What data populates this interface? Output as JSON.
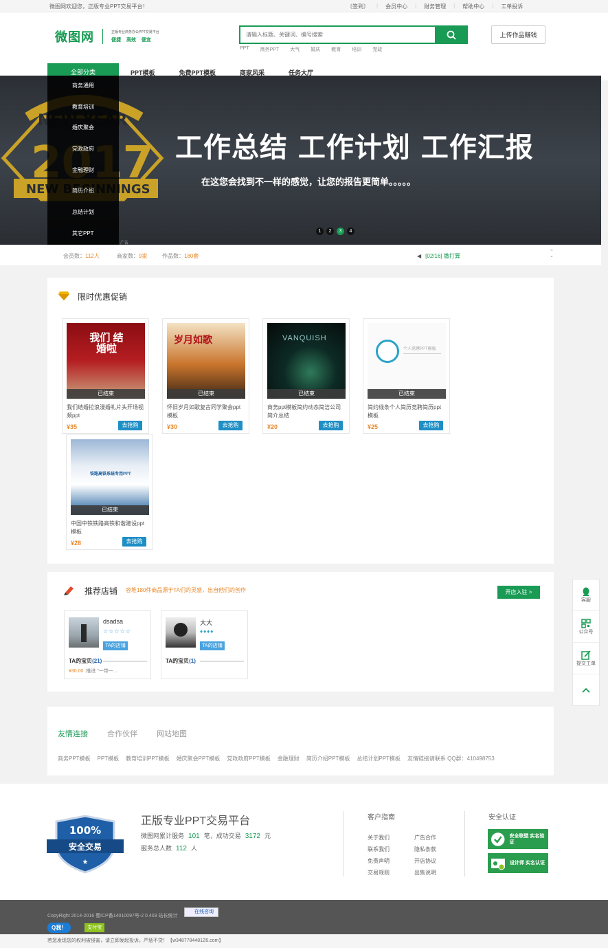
{
  "topbar": {
    "welcome": "微图网欢迎您，正版专业PPT交易平台！",
    "links": [
      "〔签到〕",
      "会员中心",
      "财务管理",
      "帮助中心",
      "工单投诉"
    ]
  },
  "header": {
    "logo": "微图网",
    "slogan": "正版专业商务办公PPT交易平台",
    "slogan2": "便捷 高效 便宜",
    "search_placeholder": "请输入标题、关键词、编号搜索",
    "hotwords": [
      "PPT",
      "商务PPT",
      "大气",
      "婚庆",
      "教育",
      "培训",
      "党政"
    ],
    "upload_label": "上传作品赚钱"
  },
  "nav": {
    "all_label": "全部分类",
    "items": [
      "PPT模板",
      "免费PPT模板",
      "商家风采",
      "任务大厅"
    ]
  },
  "categories": [
    "商务通用",
    "教育培训",
    "婚庆聚会",
    "党政政府",
    "金融理财",
    "简历介绍",
    "总结计划",
    "其它PPT"
  ],
  "banner": {
    "headline": "工作总结 工作计划 工作汇报",
    "subline": "在这您会找到不一样的感觉，让您的报告更简单。。。。。",
    "dots": [
      "1",
      "2",
      "3",
      "4"
    ],
    "active_dot": 3,
    "ad": "广告",
    "deco_text": "NEW YEAR 2017 NEW BEGINNINGS"
  },
  "stats": {
    "members_label": "会员数：",
    "members": "112人",
    "merchants_label": "商家数：",
    "merchants": "9家",
    "works_label": "作品数：",
    "works": "180套",
    "notice": "[02/16] 撒打算"
  },
  "promo": {
    "title": "限时优惠促销",
    "ended_label": "已结束",
    "buy_label": "去抢购",
    "items": [
      {
        "title": "我们结婚拉浪漫婚礼片头开场视频ppt",
        "price": "¥35"
      },
      {
        "title": "怀旧岁月如歌复古同学聚会ppt模板",
        "price": "¥30"
      },
      {
        "title": "商务ppt模板简约动态简洁公司简介总结",
        "price": "¥20"
      },
      {
        "title": "简约线条个人简历竞聘简历ppt模板",
        "price": "¥25"
      },
      {
        "title": "中国中铁铁路高铁和谐建设ppt模板",
        "price": "¥28"
      }
    ],
    "img_texts": [
      "我们 结婚啦",
      "岁月如歌",
      "VANQUISH",
      "个人竞聘PPT模板",
      "铁路高铁系统专用PPT"
    ]
  },
  "shops": {
    "title": "推荐店铺",
    "subtitle": "容堆180件商品源于TA们的灵感，出自他们的创作",
    "open_label": "开店入驻 >",
    "tag_label": "TA的店铺",
    "items": [
      {
        "name": "dsadsa",
        "rate": "☆☆☆☆☆",
        "count_label": "TA的宝贝",
        "count": "(21)",
        "price": "¥30.00",
        "desc": "推进 \"一带一..."
      },
      {
        "name": "大大",
        "rate": "♦♦♦♦",
        "count_label": "TA的宝贝",
        "count": "(1)"
      }
    ]
  },
  "links": {
    "tabs": [
      "友情连接",
      "合作伙伴",
      "网站地图"
    ],
    "items": [
      "商务PPT模板",
      "PPT模板",
      "教育培训PPT模板",
      "婚庆聚会PPT模板",
      "党政政府PPT模板",
      "金融理财",
      "简历介绍PPT模板",
      "总结计划PPT模板",
      "友情链接请联系 QQ群：410498753"
    ]
  },
  "float": [
    "客服",
    "公众号",
    "提交工单",
    ""
  ],
  "footer": {
    "badge_top": "100%",
    "badge_bottom": "安全交易",
    "title": "正版专业PPT交易平台",
    "line1_a": "微图网累计服务",
    "line1_n1": "101",
    "line1_b": "笔，成功交易",
    "line1_n2": "3172",
    "line1_c": "元",
    "line2_a": "服务总人数",
    "line2_n": "112",
    "line2_b": "人",
    "guide_title": "客户指南",
    "guide_col1": [
      "关于我们",
      "联系我们",
      "免责声明",
      "交易规则"
    ],
    "guide_col2": [
      "广告合作",
      "隐私条款",
      "开店协议",
      "出售说明"
    ],
    "cert_title": "安全认证",
    "certs": [
      "安全联盟 实名验证",
      "设计师 实名认证"
    ]
  },
  "bottom": {
    "copyright": "CopyRight 2014-2016 蜀ICP备14010097号-2 0.403 站长统计",
    "online": "在线咨询",
    "qq": "Q我！",
    "pay": "支付宝",
    "report": "若您发现您的权利被侵害，请立即发起投诉，严惩不贷！【w3487784481Z6.com】"
  },
  "colors": {
    "brand": "#1a9b55",
    "accent": "#e8892b",
    "link_blue": "#1e8fc5"
  }
}
